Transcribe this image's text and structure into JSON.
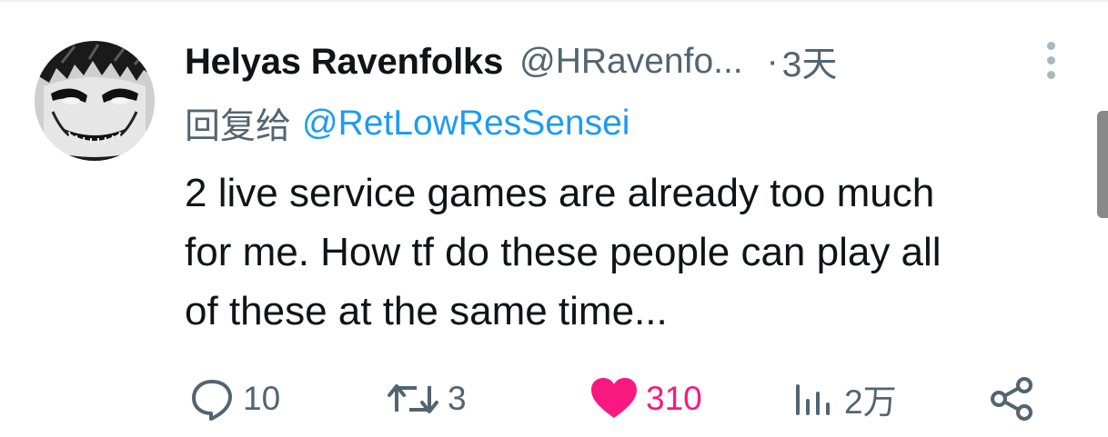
{
  "post": {
    "author": {
      "display_name": "Helyas Ravenfolks",
      "handle": "@HRavenfo...",
      "avatar_icon": "avatar-image"
    },
    "separator": "·",
    "time": "3天",
    "reply_prefix": "回复给",
    "reply_to": "@RetLowResSensei",
    "text": "2 live service games are already too much\nfor me. How tf do these people can play all\nof these at the same time..."
  },
  "actions": {
    "reply": {
      "icon": "reply-icon",
      "count": "10"
    },
    "repost": {
      "icon": "repost-icon",
      "count": "3"
    },
    "like": {
      "icon": "heart-icon",
      "count": "310",
      "liked": true
    },
    "views": {
      "icon": "analytics-icon",
      "count": "2万"
    },
    "share": {
      "icon": "share-icon"
    }
  },
  "colors": {
    "text_primary": "#0f1419",
    "text_secondary": "#536471",
    "link": "#1d9bf0",
    "like": "#f91880"
  }
}
